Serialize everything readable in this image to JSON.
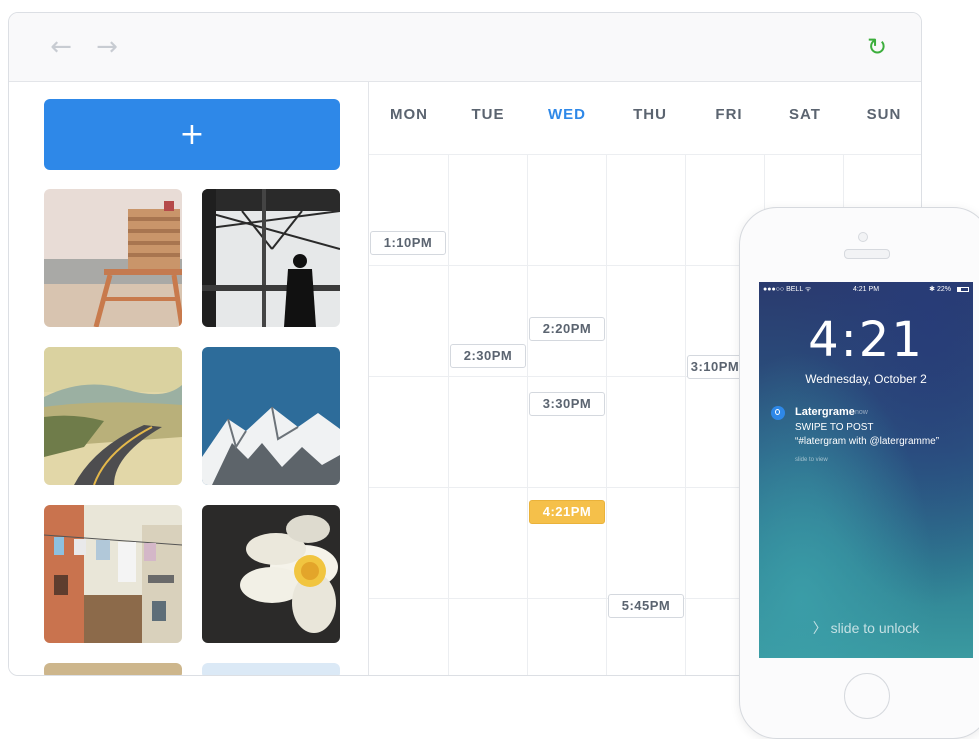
{
  "toolbar": {
    "back_icon": "←",
    "forward_icon": "→",
    "refresh_icon": "↻",
    "refresh_color": "#3cae3c"
  },
  "sidebar": {
    "add_label": "+",
    "add_color": "#2e88e8",
    "photos": [
      {
        "subject": "lifeguard-tower"
      },
      {
        "subject": "man-at-window"
      },
      {
        "subject": "desert-road"
      },
      {
        "subject": "snowy-mountains"
      },
      {
        "subject": "street-laundry"
      },
      {
        "subject": "white-flower"
      },
      {
        "subject": "partial-photo"
      },
      {
        "subject": "partial-photo"
      }
    ]
  },
  "calendar": {
    "days": [
      "MON",
      "TUE",
      "WED",
      "THU",
      "FRI",
      "SAT",
      "SUN"
    ],
    "active_day": "WED",
    "active_color": "#2e88e8",
    "slots": [
      {
        "day": "MON",
        "time": "1:10PM"
      },
      {
        "day": "TUE",
        "time": "2:30PM"
      },
      {
        "day": "WED",
        "time": "2:20PM"
      },
      {
        "day": "WED",
        "time": "3:30PM"
      },
      {
        "day": "WED",
        "time": "4:21PM",
        "current": true
      },
      {
        "day": "THU",
        "time": "5:45PM"
      },
      {
        "day": "FRI",
        "time": "3:10PM"
      }
    ],
    "current_color": "#f5c04a"
  },
  "phone": {
    "status": {
      "carrier": "●●●○○ BELL ᯤ",
      "time": "4:21 PM",
      "battery": "✱ 22%"
    },
    "lock_time": "4:21",
    "lock_date": "Wednesday, October 2",
    "notification": {
      "app": "Latergrame",
      "age": "now",
      "title": "SWIPE TO POST",
      "body": "“#latergram with @latergramme”",
      "hint": "slide to view"
    },
    "unlock_text": "〉 slide to unlock"
  }
}
